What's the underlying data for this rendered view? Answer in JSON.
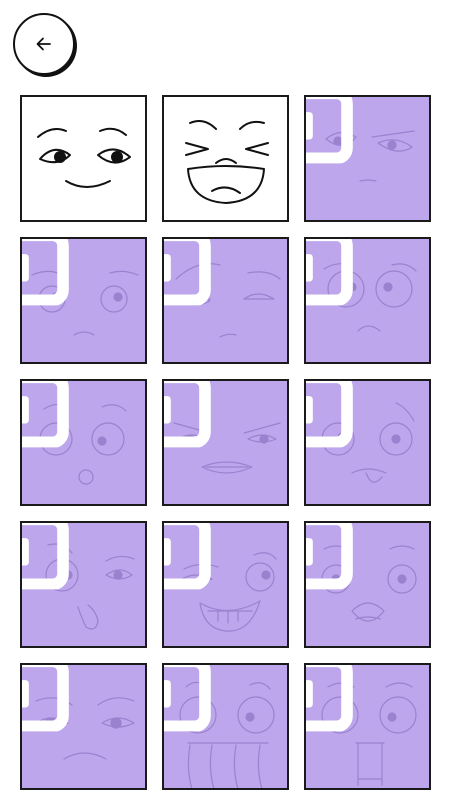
{
  "header": {
    "back_icon": "arrow-left-icon"
  },
  "colors": {
    "unlocked_bg": "#ffffff",
    "locked_bg": "#bda6ec",
    "border": "#1a1a1a",
    "line_unlocked": "#111111",
    "line_locked": "#9a82cf",
    "lock": "#ffffff"
  },
  "lock_icon": "padlock-icon",
  "faces": [
    {
      "id": "happy-smirk",
      "locked": false
    },
    {
      "id": "laughing",
      "locked": false
    },
    {
      "id": "suspicious",
      "locked": true
    },
    {
      "id": "sad",
      "locked": true
    },
    {
      "id": "unimpressed",
      "locked": true
    },
    {
      "id": "worried",
      "locked": true
    },
    {
      "id": "surprised-whistle",
      "locked": true
    },
    {
      "id": "angry-grimace",
      "locked": true
    },
    {
      "id": "smirk-tongue",
      "locked": true
    },
    {
      "id": "confused-tongue",
      "locked": true
    },
    {
      "id": "grinning",
      "locked": true
    },
    {
      "id": "shocked",
      "locked": true
    },
    {
      "id": "frowning",
      "locked": true
    },
    {
      "id": "drooling",
      "locked": true
    },
    {
      "id": "tongue-out",
      "locked": true
    }
  ]
}
